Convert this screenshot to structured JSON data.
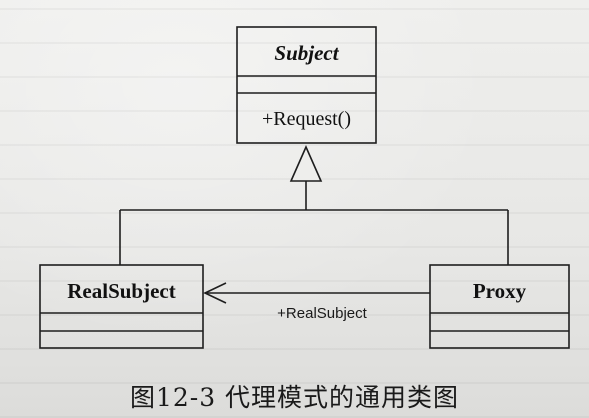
{
  "classes": {
    "subject": {
      "name": "Subject",
      "operation": "+Request()"
    },
    "real_subject": {
      "name": "RealSubject"
    },
    "proxy": {
      "name": "Proxy"
    }
  },
  "association": {
    "label": "+RealSubject"
  },
  "caption": "图12-3   代理模式的通用类图"
}
